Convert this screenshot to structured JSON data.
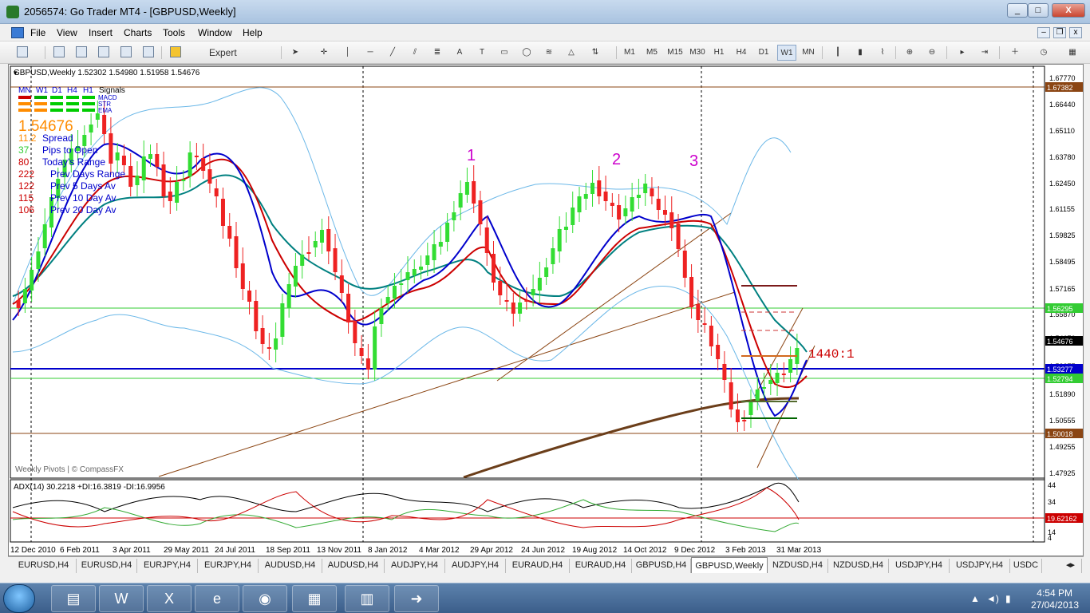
{
  "window": {
    "title": "2056574: Go Trader MT4 - [GBPUSD,Weekly]",
    "buttons": [
      "_",
      "□",
      "X"
    ]
  },
  "menu": {
    "items": [
      "File",
      "View",
      "Insert",
      "Charts",
      "Tools",
      "Window",
      "Help"
    ]
  },
  "toolbar": {
    "expert_advisors_label": "Expert Advisors",
    "timeframes": [
      "M1",
      "M5",
      "M15",
      "M30",
      "H1",
      "H4",
      "D1",
      "W1",
      "MN"
    ],
    "active_timeframe": "W1"
  },
  "chart": {
    "header": "GBPUSD,Weekly  1.52302 1.54980 1.51958 1.54676",
    "signals_header": [
      "MN",
      "W1",
      "D1",
      "H4",
      "H1",
      "Signals"
    ],
    "signal_rows": [
      "MACD",
      "STR",
      "EMA"
    ],
    "price_big": "1.54676",
    "info_rows": [
      {
        "value": "11.2",
        "label": "Spread"
      },
      {
        "value": "37",
        "label": "Pips to Open"
      },
      {
        "value": "80",
        "label": "Today's Range"
      },
      {
        "value": "222",
        "label": "Prev Days Range"
      },
      {
        "value": "122",
        "label": "Prev 5 Days Av"
      },
      {
        "value": "115",
        "label": "Prev 10 Day Av"
      },
      {
        "value": "106",
        "label": "Prev 20 Day Av"
      }
    ],
    "wave_labels": [
      "1",
      "2",
      "3"
    ],
    "annotation": "1440:1",
    "footer_label": "Weekly Pivots | © CompassFX",
    "price_axis": [
      "1.67770",
      "1.66440",
      "1.65110",
      "1.63780",
      "1.62450",
      "1.61155",
      "1.59825",
      "1.58495",
      "1.57165",
      "1.55870",
      "1.54676",
      "1.53277",
      "1.51890",
      "1.50555",
      "1.49255",
      "1.47925"
    ],
    "price_tags": [
      {
        "text": "1.67382",
        "color": "#8b4513"
      },
      {
        "text": "1.56295",
        "color": "#33cc33"
      },
      {
        "text": "1.54676",
        "color": "#000000"
      },
      {
        "text": "1.53277",
        "color": "#0000cc"
      },
      {
        "text": "1.52794",
        "color": "#33cc33"
      },
      {
        "text": "1.50018",
        "color": "#8b4513"
      }
    ],
    "adx_label": "ADX(14) 30.2218 +DI:16.3819 -DI:16.9956",
    "adx_axis": [
      "44",
      "34",
      "14",
      "4"
    ],
    "adx_tag": "19.62162",
    "date_axis": [
      "12 Dec 2010",
      "6 Feb 2011",
      "3 Apr 2011",
      "29 May 2011",
      "24 Jul 2011",
      "18 Sep 2011",
      "13 Nov 2011",
      "8 Jan 2012",
      "4 Mar 2012",
      "29 Apr 2012",
      "24 Jun 2012",
      "19 Aug 2012",
      "14 Oct 2012",
      "9 Dec 2012",
      "3 Feb 2013",
      "31 Mar 2013"
    ]
  },
  "tabs": {
    "items": [
      "EURUSD,H4",
      "EURUSD,H4",
      "EURJPY,H4",
      "EURJPY,H4",
      "AUDUSD,H4",
      "AUDUSD,H4",
      "AUDJPY,H4",
      "AUDJPY,H4",
      "EURAUD,H4",
      "EURAUD,H4",
      "GBPUSD,H4",
      "GBPUSD,Weekly",
      "NZDUSD,H4",
      "NZDUSD,H4",
      "USDJPY,H4",
      "USDJPY,H4",
      "USDC"
    ],
    "active": "GBPUSD,Weekly"
  },
  "taskbar": {
    "time": "4:54 PM",
    "date": "27/04/2013"
  }
}
